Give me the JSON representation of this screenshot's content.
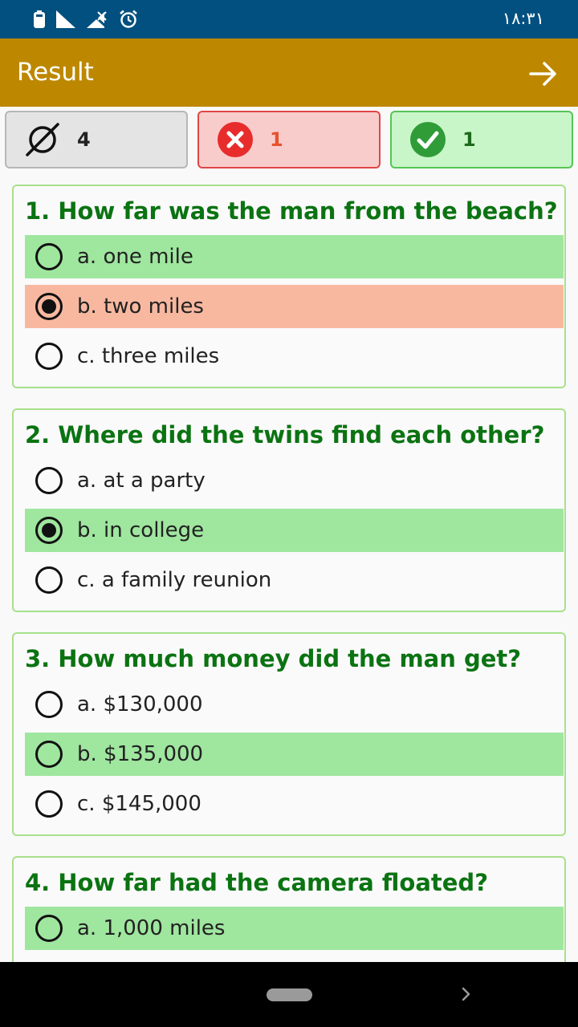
{
  "status_bar": {
    "time": "۱۸:۳۱",
    "icons": [
      "battery-icon",
      "cell-signal-icon",
      "no-signal-icon",
      "alarm-clock-icon"
    ]
  },
  "app_bar": {
    "title": "Result",
    "action_icon": "arrow-right-icon"
  },
  "summary": {
    "skipped": {
      "icon": "empty-set-icon",
      "count": "4"
    },
    "wrong": {
      "icon": "x-circle-icon",
      "count": "1"
    },
    "correct": {
      "icon": "check-circle-icon",
      "count": "1"
    }
  },
  "questions": [
    {
      "text": "1. How far was the man from the beach?",
      "options": [
        {
          "label": "a. one mile",
          "state": "correct",
          "selected": false
        },
        {
          "label": "b. two miles",
          "state": "wrong",
          "selected": true
        },
        {
          "label": "c. three miles",
          "state": "none",
          "selected": false
        }
      ]
    },
    {
      "text": "2. Where did the twins find each other?",
      "options": [
        {
          "label": "a. at a party",
          "state": "none",
          "selected": false
        },
        {
          "label": "b. in college",
          "state": "correct",
          "selected": true
        },
        {
          "label": "c. a family reunion",
          "state": "none",
          "selected": false
        }
      ]
    },
    {
      "text": "3. How much money did the man get?",
      "options": [
        {
          "label": "a. $130,000",
          "state": "none",
          "selected": false
        },
        {
          "label": "b. $135,000",
          "state": "correct",
          "selected": false
        },
        {
          "label": "c. $145,000",
          "state": "none",
          "selected": false
        }
      ]
    },
    {
      "text": "4. How far had the camera floated?",
      "options": [
        {
          "label": "a. 1,000 miles",
          "state": "correct",
          "selected": false
        }
      ]
    }
  ],
  "colors": {
    "status_bar": "#02507f",
    "app_bar": "#bd8800",
    "question_text": "#0b7312",
    "correct_highlight": "#9fe69f",
    "wrong_highlight": "#f8b8a0"
  }
}
